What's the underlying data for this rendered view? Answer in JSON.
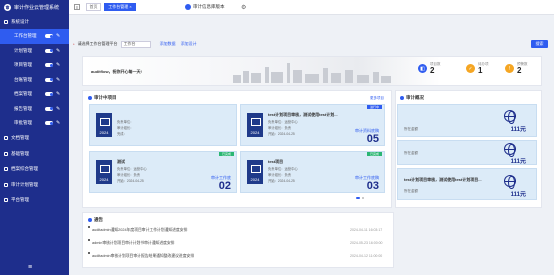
{
  "app": {
    "title": "审计作业云管理系统",
    "version": "审计信息库版本"
  },
  "sidebar": {
    "system": "系统设计",
    "subs": [
      {
        "label": "工作台管理",
        "active": true
      },
      {
        "label": "计划管理",
        "active": false
      },
      {
        "label": "项目管理",
        "active": false
      },
      {
        "label": "台账管理",
        "active": false
      },
      {
        "label": "档案管理",
        "active": false
      },
      {
        "label": "报告管理",
        "active": false
      },
      {
        "label": "审批管理",
        "active": false
      }
    ],
    "items": [
      "文档管理",
      "基础管理",
      "档案综合管理",
      "审计计划管理",
      "平台管理"
    ],
    "bottom_icon": "menu-icon"
  },
  "tabs": [
    "首页",
    "工作台管理 ×"
  ],
  "toolbar": {
    "label": "请选择工作台管理平台",
    "select_value": "工作台",
    "link1": "添加数据",
    "link2": "添加设计",
    "search": "搜索"
  },
  "hero": {
    "welcome": "auditflow，祝你开心每一天!"
  },
  "stats": [
    {
      "label": "项目数",
      "value": "2",
      "color": "#2f5cf0"
    },
    {
      "label": "待办项",
      "value": "1",
      "color": "#f5a623"
    },
    {
      "label": "预警数",
      "value": "2",
      "color": "#f5a623"
    }
  ],
  "projects": {
    "title": "审计中项目",
    "more": "更多项目",
    "cards": [
      {
        "year": "2024",
        "title": "",
        "meta": [
          "负责单位：",
          "审计组长：",
          "完成："
        ],
        "label": "",
        "num": "",
        "ribbon": ""
      },
      {
        "year": "2024",
        "title": "test计划项目审核，测试使用test计划...",
        "meta": [
          "负责单位：运营中心",
          "审计组长：负责",
          "开始：2024-04-25"
        ],
        "label": "审计资料底稿",
        "num": "05",
        "ribbon": "进行中"
      },
      {
        "year": "2024",
        "title": "测试",
        "meta": [
          "负责单位：运营中心",
          "审计组长：负责",
          "开始：2024-04-25"
        ],
        "label": "审计工作底",
        "num": "02",
        "ribbon": "已完成"
      },
      {
        "year": "2024",
        "title": "test项目",
        "meta": [
          "负责单位：运营中心",
          "审计组长：负责",
          "开始：2024-04-25"
        ],
        "label": "审计工作底稿",
        "num": "03",
        "ribbon": "已完成"
      }
    ]
  },
  "overview": {
    "title": "审计概况",
    "cards": [
      {
        "label": "所在金额",
        "count": "111元"
      },
      {
        "label": "所在金额",
        "count": "111元"
      },
      {
        "title": "test计划项目审核，测试使用test计划项目...",
        "label": "所在金额",
        "count": "111元"
      }
    ]
  },
  "notices": {
    "title": "通告",
    "items": [
      {
        "text": "auditadmin通知2024年度项目审计工作计划通知进度安排",
        "date": "2024-04-11 16:03:17"
      },
      {
        "text": "admin审核计划项目审计计划书审计通知进度安排",
        "date": "2024-05-23 16:00:00"
      },
      {
        "text": "auditadmin审核计划项目审计报告结果通知整改建议进度安排",
        "date": "2024-04-12 11:00:00"
      }
    ]
  }
}
